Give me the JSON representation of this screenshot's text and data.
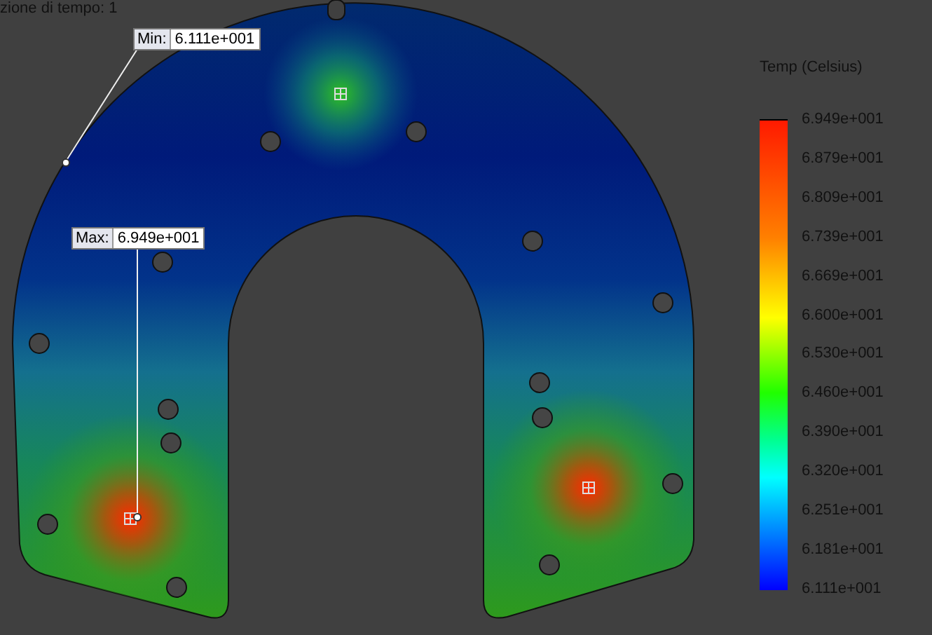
{
  "header": {
    "text": "zione di tempo: 1"
  },
  "plot": {
    "min_probe": {
      "label": "Min:",
      "value": "6.111e+001"
    },
    "max_probe": {
      "label": "Max:",
      "value": "6.949e+001"
    }
  },
  "legend": {
    "title": "Temp (Celsius)",
    "ticks": [
      "6.949e+001",
      "6.879e+001",
      "6.809e+001",
      "6.739e+001",
      "6.669e+001",
      "6.600e+001",
      "6.530e+001",
      "6.460e+001",
      "6.390e+001",
      "6.320e+001",
      "6.251e+001",
      "6.181e+001",
      "6.111e+001"
    ]
  }
}
